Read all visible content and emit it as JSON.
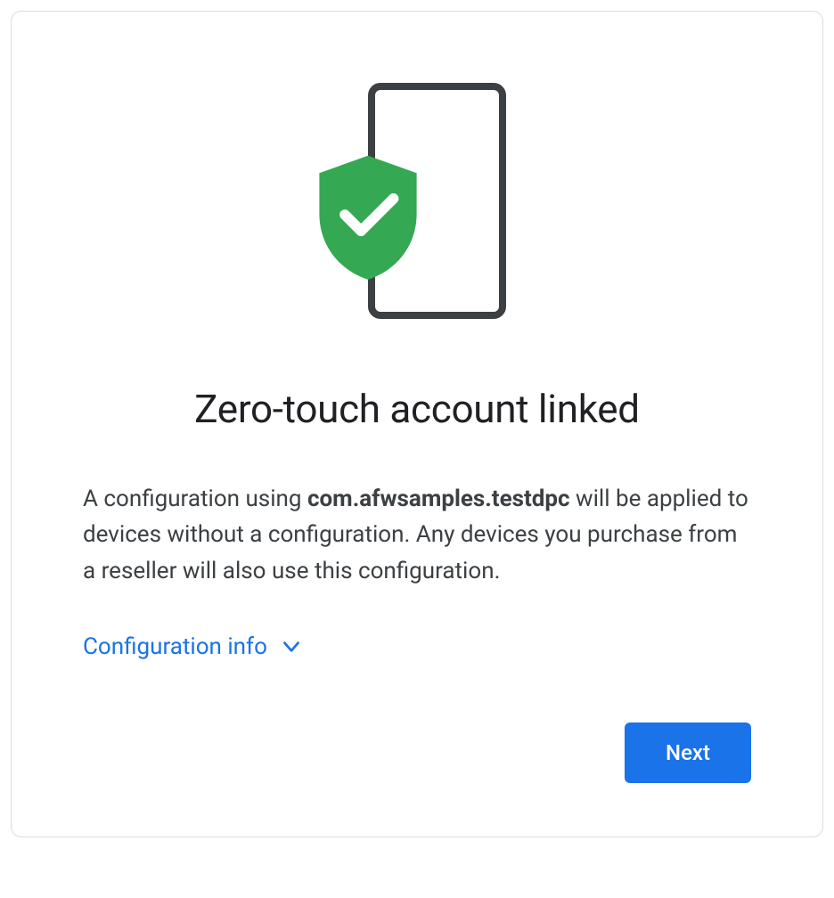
{
  "heading": "Zero-touch account linked",
  "description": {
    "part1": "A configuration using ",
    "bold": "com.afwsamples.testdpc",
    "part2": " will be applied to devices without a configuration. Any devices you purchase from a reseller will also use this configuration."
  },
  "config_toggle_label": "Configuration info",
  "next_button_label": "Next",
  "colors": {
    "accent": "#1a73e8",
    "shield": "#34a853"
  }
}
